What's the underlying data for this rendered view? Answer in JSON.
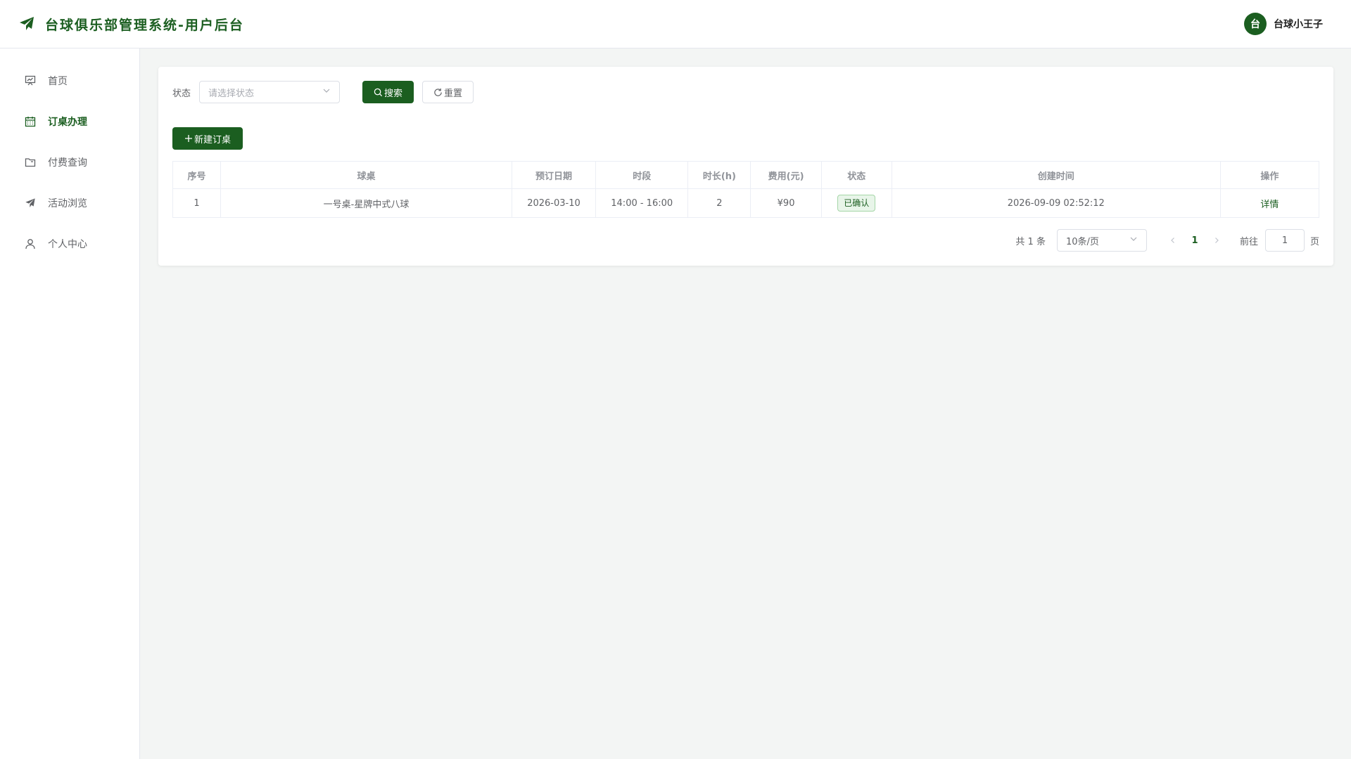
{
  "header": {
    "title": "台球俱乐部管理系统-用户后台",
    "logo_icon": "paper-plane-icon",
    "user": {
      "avatar_char": "台",
      "name": "台球小王子"
    }
  },
  "sidebar": {
    "items": [
      {
        "label": "首页",
        "icon": "presentation-icon",
        "active": false
      },
      {
        "label": "订桌办理",
        "icon": "calendar-icon",
        "active": true
      },
      {
        "label": "付费查询",
        "icon": "folder-icon",
        "active": false
      },
      {
        "label": "活动浏览",
        "icon": "paper-plane-icon",
        "active": false
      },
      {
        "label": "个人中心",
        "icon": "user-icon",
        "active": false
      }
    ]
  },
  "filter": {
    "status_label": "状态",
    "status_placeholder": "请选择状态",
    "search_label": "搜索",
    "reset_label": "重置"
  },
  "actions": {
    "new_label": "新建订桌"
  },
  "table": {
    "columns": [
      "序号",
      "球桌",
      "预订日期",
      "时段",
      "时长(h)",
      "费用(元)",
      "状态",
      "创建时间",
      "操作"
    ],
    "rows": [
      {
        "index": "1",
        "table": "一号桌-星牌中式八球",
        "date": "2026-03-10",
        "slot": "14:00 - 16:00",
        "hours": "2",
        "fee": "¥90",
        "status": "已确认",
        "created": "2026-09-09 02:52:12",
        "action": "详情"
      }
    ]
  },
  "pagination": {
    "total_text": "共 1 条",
    "page_size": "10条/页",
    "current_page": "1",
    "goto_label": "前往",
    "goto_value": "1",
    "page_suffix": "页"
  },
  "colors": {
    "primary": "#1b5e20",
    "background": "#f3f5f4"
  }
}
